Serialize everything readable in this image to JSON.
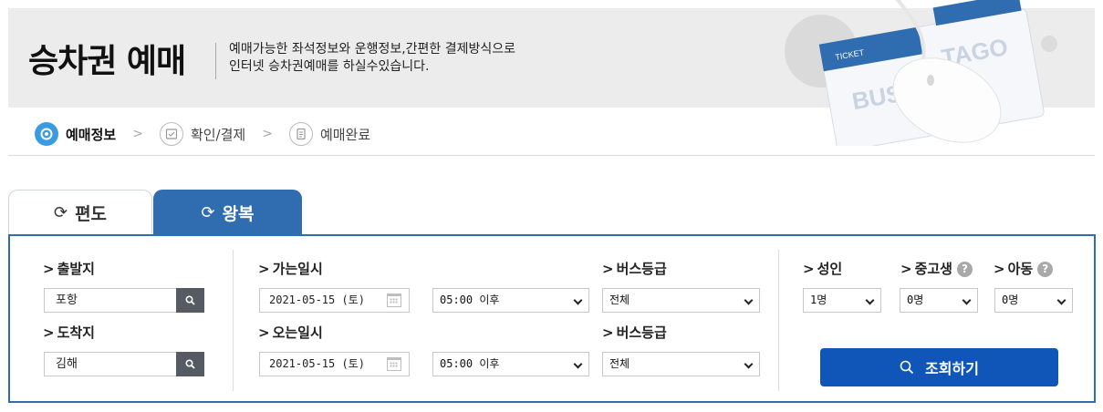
{
  "header": {
    "title": "승차권 예매",
    "desc_line1": "예매가능한 좌석정보와 운행정보,간편한 결제방식으로",
    "desc_line2": "인터넷 승차권예매를 하실수있습니다.",
    "deco_ticket": "TICKET",
    "deco_brand_left": "BUS",
    "deco_brand_right": "TAGO"
  },
  "steps": [
    {
      "label": "예매정보",
      "active": true
    },
    {
      "label": "확인/결제",
      "active": false
    },
    {
      "label": "예매완료",
      "active": false
    }
  ],
  "tabs": {
    "oneway": "편도",
    "roundtrip": "왕복"
  },
  "form": {
    "departure_label": "출발지",
    "departure_value": "포항",
    "arrival_label": "도착지",
    "arrival_value": "김해",
    "go_datetime_label": "가는일시",
    "go_date": "2021-05-15 (토)",
    "go_time": "05:00 이후",
    "return_datetime_label": "오는일시",
    "return_date": "2021-05-15 (토)",
    "return_time": "05:00 이후",
    "bus_grade_label_1": "버스등급",
    "bus_grade_value_1": "전체",
    "bus_grade_label_2": "버스등급",
    "bus_grade_value_2": "전체",
    "adult_label": "성인",
    "adult_value": "1명",
    "student_label": "중고생",
    "student_value": "0명",
    "child_label": "아동",
    "child_value": "0명",
    "search_button": "조회하기"
  },
  "colors": {
    "brand_blue": "#2f6cb0",
    "button_blue": "#0f56b8",
    "step_active": "#3b9be0"
  }
}
